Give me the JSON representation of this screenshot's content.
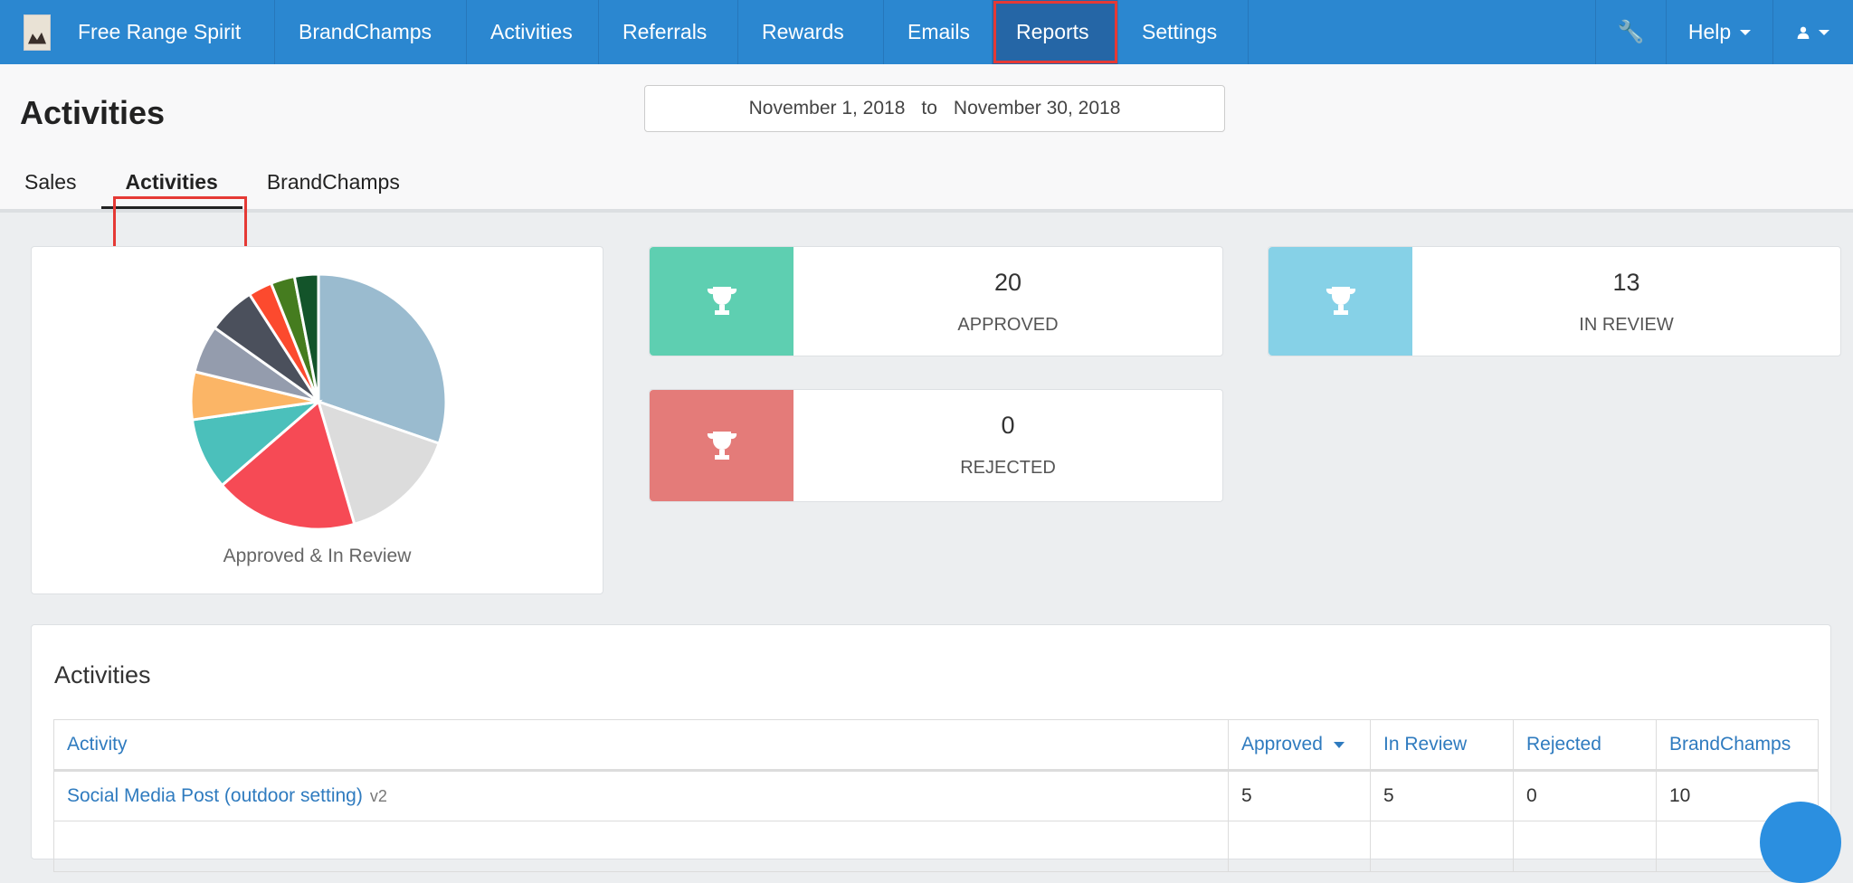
{
  "nav": {
    "brand": "Free Range Spirit",
    "items": [
      "BrandChamps",
      "Activities",
      "Referrals",
      "Rewards",
      "Emails",
      "Reports",
      "Settings"
    ],
    "active": "Reports",
    "help": "Help",
    "icons": [
      "wrench-icon",
      "user-icon"
    ]
  },
  "header": {
    "title": "Activities",
    "date_from": "November 1, 2018",
    "date_sep": "to",
    "date_to": "November 30, 2018"
  },
  "tabs": [
    {
      "label": "Sales"
    },
    {
      "label": "Activities",
      "selected": true
    },
    {
      "label": "BrandChamps"
    }
  ],
  "stats": {
    "approved": {
      "value": "20",
      "label": "APPROVED",
      "color": "#5ecfb1"
    },
    "in_review": {
      "value": "13",
      "label": "IN REVIEW",
      "color": "#86d1e7"
    },
    "rejected": {
      "value": "0",
      "label": "REJECTED",
      "color": "#e47b79"
    }
  },
  "chart_data": {
    "type": "pie",
    "title": "Approved & In Review",
    "values": [
      10,
      5,
      6,
      3,
      2,
      2,
      2,
      1,
      1,
      1
    ],
    "colors": [
      "#9abbcf",
      "#dcdcdc",
      "#f64a55",
      "#4bc0bb",
      "#fbb566",
      "#949cad",
      "#4b505c",
      "#fc4a2e",
      "#457c1f",
      "#13542a"
    ]
  },
  "table": {
    "title": "Activities",
    "headers": [
      "Activity",
      "Approved",
      "In Review",
      "Rejected",
      "BrandChamps"
    ],
    "sorted_by": "Approved",
    "rows": [
      {
        "activity": "Social Media Post (outdoor setting)",
        "version": "v2",
        "approved": "5",
        "in_review": "5",
        "rejected": "0",
        "brandchamps": "10"
      }
    ]
  }
}
